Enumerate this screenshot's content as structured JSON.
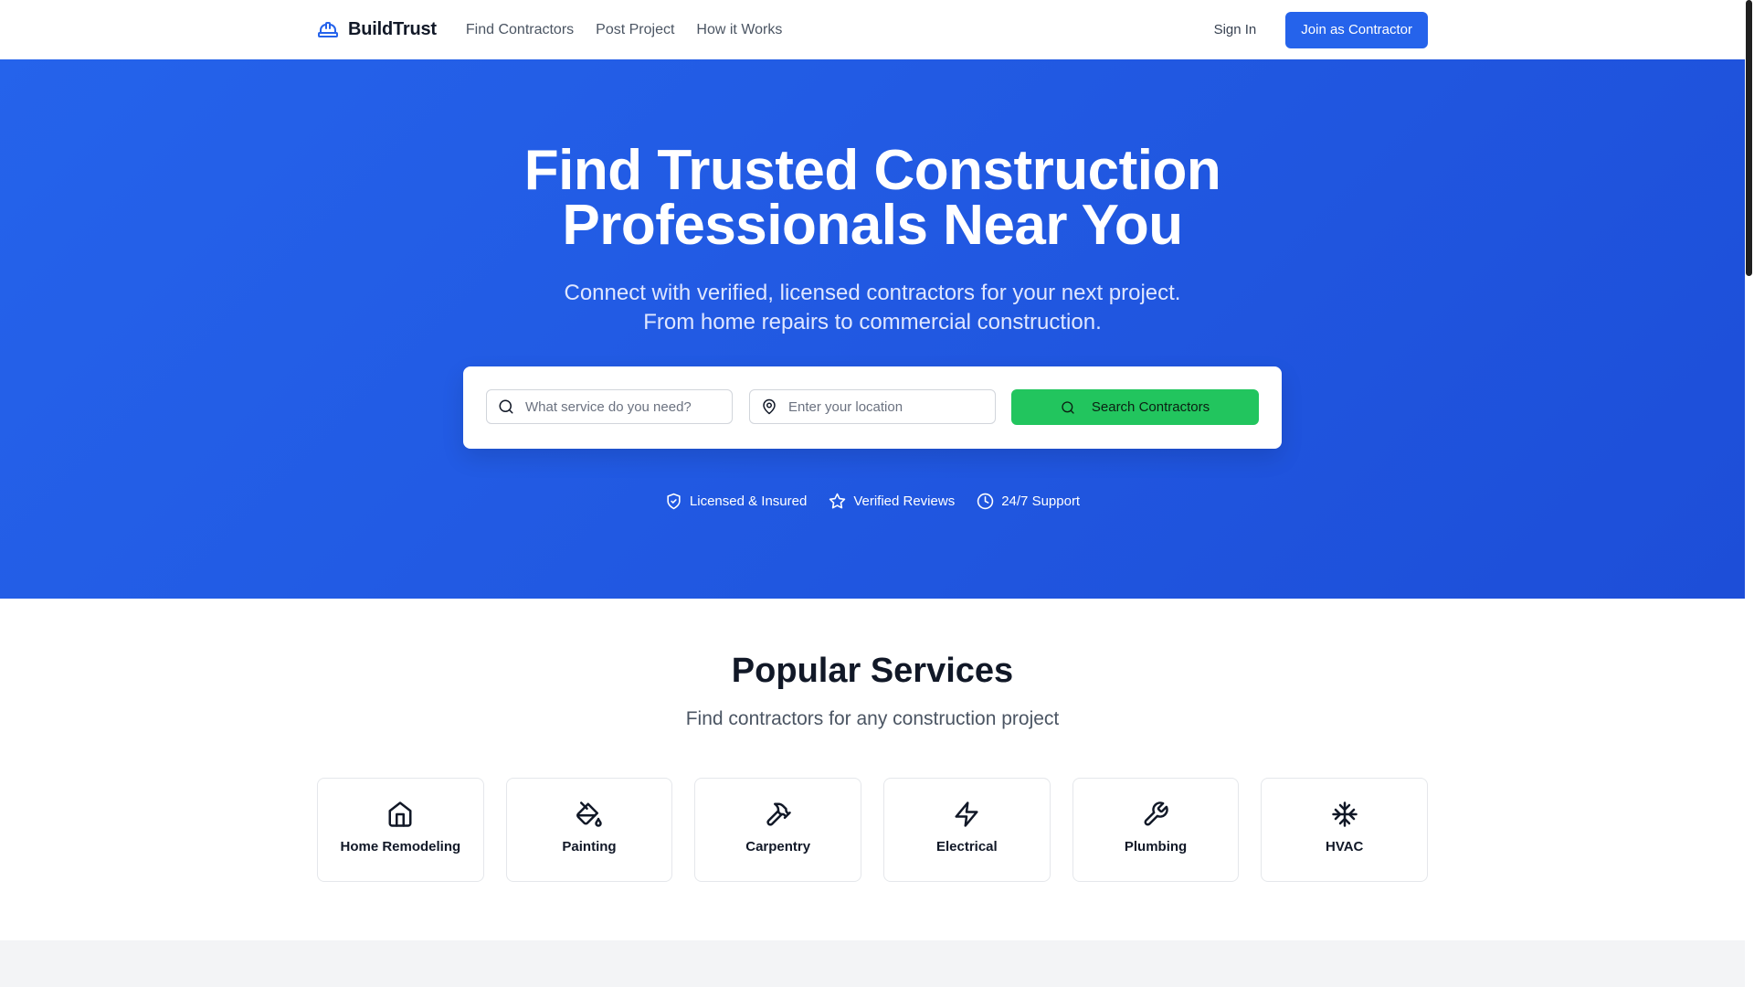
{
  "header": {
    "brand": "BuildTrust",
    "nav": [
      "Find Contractors",
      "Post Project",
      "How it Works"
    ],
    "sign_in": "Sign In",
    "join_button": "Join as Contractor"
  },
  "hero": {
    "title_line1": "Find Trusted Construction",
    "title_line2": "Professionals Near You",
    "subtitle_line1": "Connect with verified, licensed contractors for your next project.",
    "subtitle_line2": "From home repairs to commercial construction.",
    "search": {
      "service_placeholder": "What service do you need?",
      "service_value": "",
      "location_placeholder": "Enter your location",
      "location_value": "",
      "button": "Search Contractors"
    },
    "trust_badges": [
      {
        "label": "Licensed & Insured",
        "icon": "shield-check-icon"
      },
      {
        "label": "Verified Reviews",
        "icon": "star-icon"
      },
      {
        "label": "24/7 Support",
        "icon": "clock-icon"
      }
    ]
  },
  "services": {
    "title": "Popular Services",
    "subtitle": "Find contractors for any construction project",
    "items": [
      {
        "label": "Home Remodeling",
        "icon": "home-icon"
      },
      {
        "label": "Painting",
        "icon": "paint-bucket-icon"
      },
      {
        "label": "Carpentry",
        "icon": "hammer-icon"
      },
      {
        "label": "Electrical",
        "icon": "lightning-icon"
      },
      {
        "label": "Plumbing",
        "icon": "wrench-icon"
      },
      {
        "label": "HVAC",
        "icon": "snowflake-icon"
      }
    ]
  },
  "colors": {
    "primary": "#2563eb",
    "hero_gradient_end": "#1d4ed8",
    "search_button": "#22c55e",
    "footer_band": "#f3f4f6"
  }
}
